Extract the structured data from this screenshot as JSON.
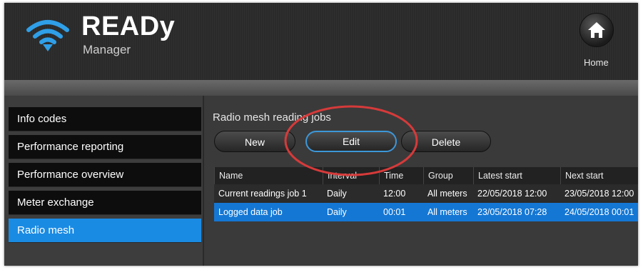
{
  "app": {
    "title": "READy",
    "subtitle": "Manager",
    "home_label": "Home"
  },
  "sidebar": {
    "items": [
      {
        "label": "Info codes"
      },
      {
        "label": "Performance reporting"
      },
      {
        "label": "Performance overview"
      },
      {
        "label": "Meter exchange"
      },
      {
        "label": "Radio mesh",
        "active": true
      }
    ]
  },
  "main": {
    "section_title": "Radio mesh reading jobs",
    "buttons": {
      "new": "New",
      "edit": "Edit",
      "delete": "Delete"
    },
    "table": {
      "columns": [
        "Name",
        "Interval",
        "Time",
        "Group",
        "Latest start",
        "Next start"
      ],
      "rows": [
        [
          "Current readings job 1",
          "Daily",
          "12:00",
          "All meters",
          "22/05/2018 12:00",
          "23/05/2018 12:00"
        ],
        [
          "Logged data job",
          "Daily",
          "00:01",
          "All meters",
          "23/05/2018 07:28",
          "24/05/2018 00:01"
        ]
      ],
      "selected_row": 1
    }
  },
  "colors": {
    "accent": "#1a8be3",
    "selection": "#1477d4",
    "annotation": "#d63a3a"
  }
}
